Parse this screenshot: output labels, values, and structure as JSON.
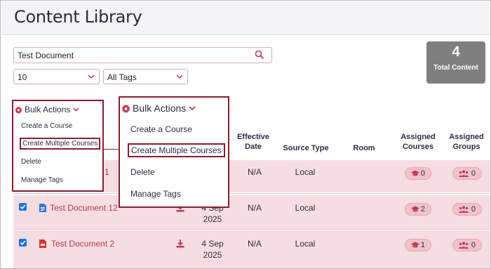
{
  "page": {
    "title": "Content Library"
  },
  "search": {
    "value": "Test Document",
    "placeholder": ""
  },
  "filters": {
    "count_value": "10",
    "tags_value": "All Tags"
  },
  "total_card": {
    "count": "4",
    "label": "Total Content"
  },
  "columns": {
    "effective_date": [
      "Effective",
      "Date"
    ],
    "source_type": "Source Type",
    "room": "Room",
    "assigned_courses": [
      "Assigned",
      "Courses"
    ],
    "assigned_groups": [
      "Assigned",
      "Groups"
    ]
  },
  "rows": [
    {
      "name_partial": "1",
      "date": "N/A",
      "source": "Local",
      "courses": "0",
      "groups": "0"
    },
    {
      "name": "Test Document 12",
      "date": [
        "4 Sep",
        "2025"
      ],
      "effective": "N/A",
      "source": "Local",
      "courses": "2",
      "groups": "0"
    },
    {
      "name": "Test Document 2",
      "date": [
        "4 Sep",
        "2025"
      ],
      "effective": "N/A",
      "source": "Local",
      "courses": "1",
      "groups": "0"
    }
  ],
  "bulk_menu": {
    "label": "Bulk Actions",
    "items": [
      "Create a Course",
      "Create Multiple Courses",
      "Delete",
      "Manage Tags"
    ]
  },
  "colors": {
    "accent": "#c0394e",
    "row_highlight": "#f6dde2",
    "callout": "#8b1e2d",
    "checkbox": "#1a73e8"
  },
  "icons": {
    "search": "search-icon",
    "gear": "gear-icon",
    "doc": "document-icon",
    "pdf": "pdf-icon",
    "download": "download-icon",
    "courses": "graduation-cap-icon",
    "groups": "group-icon"
  }
}
